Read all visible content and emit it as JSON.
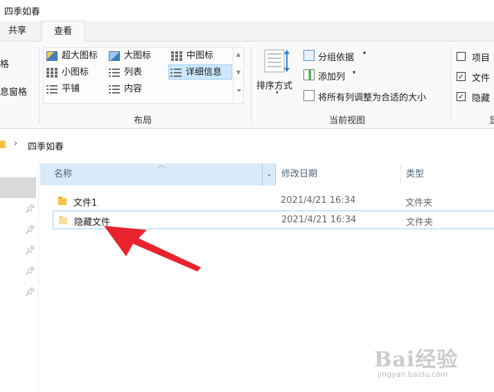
{
  "window": {
    "title": "四季如春"
  },
  "tabs": [
    {
      "label": "共享"
    },
    {
      "label": "查看"
    }
  ],
  "ribbon": {
    "pane": {
      "partial_label_1": "格",
      "partial_label_2": "息窗格"
    },
    "layout": {
      "group_label": "布局",
      "items": [
        {
          "label": "超大图标",
          "icon": "extra-large-icons-icon"
        },
        {
          "label": "大图标",
          "icon": "large-icons-icon"
        },
        {
          "label": "中图标",
          "icon": "medium-icons-icon"
        },
        {
          "label": "小图标",
          "icon": "small-icons-icon"
        },
        {
          "label": "列表",
          "icon": "list-icon"
        },
        {
          "label": "详细信息",
          "icon": "details-icon",
          "selected": true
        },
        {
          "label": "平铺",
          "icon": "tiles-icon"
        },
        {
          "label": "内容",
          "icon": "content-icon"
        }
      ]
    },
    "current_view": {
      "group_label": "当前视图",
      "sort_by": "排序方式",
      "group_by": "分组依据",
      "add_column": "添加列",
      "size_columns": "将所有列调整为合适的大小"
    },
    "show_hide": {
      "item_checkboxes": {
        "label": "项目",
        "checked": false
      },
      "file_extensions": {
        "label": "文件",
        "checked": true
      },
      "hidden_items": {
        "label": "隐藏",
        "checked": true
      },
      "partial_label": "显"
    }
  },
  "address": {
    "path": "四季如春"
  },
  "columns": [
    {
      "label": "名称"
    },
    {
      "label": "修改日期"
    },
    {
      "label": "类型"
    }
  ],
  "files": [
    {
      "name": "文件1",
      "modified": "2021/4/21 16:34",
      "type": "文件夹",
      "hidden": false
    },
    {
      "name": "隐藏文件",
      "modified": "2021/4/21 16:34",
      "type": "文件夹",
      "hidden": true
    }
  ],
  "watermark": {
    "brand": "Bai经验",
    "url": "jingyan.baidu.com"
  },
  "colors": {
    "accent": "#cce8ff",
    "header_selected": "#d9ebf9",
    "folder": "#f4c542",
    "arrow": "#e8232e"
  }
}
